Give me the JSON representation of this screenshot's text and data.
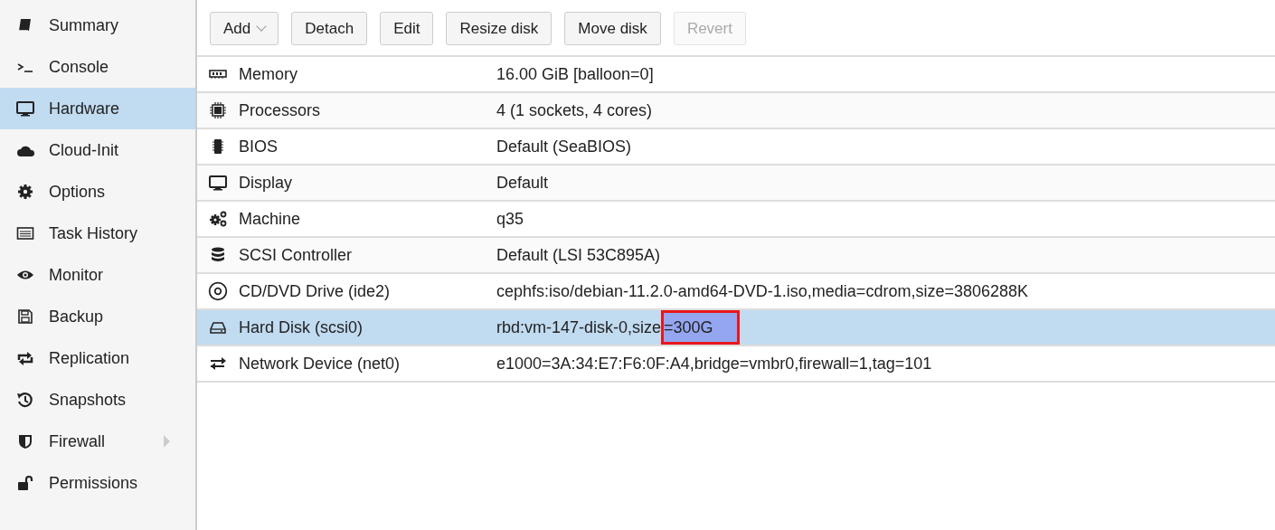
{
  "sidebar": {
    "items": [
      {
        "label": "Summary",
        "selected": false
      },
      {
        "label": "Console",
        "selected": false
      },
      {
        "label": "Hardware",
        "selected": true
      },
      {
        "label": "Cloud-Init",
        "selected": false
      },
      {
        "label": "Options",
        "selected": false
      },
      {
        "label": "Task History",
        "selected": false
      },
      {
        "label": "Monitor",
        "selected": false
      },
      {
        "label": "Backup",
        "selected": false
      },
      {
        "label": "Replication",
        "selected": false
      },
      {
        "label": "Snapshots",
        "selected": false
      },
      {
        "label": "Firewall",
        "selected": false,
        "expanded": false
      },
      {
        "label": "Permissions",
        "selected": false
      }
    ]
  },
  "toolbar": {
    "buttons": [
      {
        "label": "Add",
        "disabled": false,
        "menu": true
      },
      {
        "label": "Detach",
        "disabled": false
      },
      {
        "label": "Edit",
        "disabled": false
      },
      {
        "label": "Resize disk",
        "disabled": false
      },
      {
        "label": "Move disk",
        "disabled": false
      },
      {
        "label": "Revert",
        "disabled": true
      }
    ]
  },
  "table": {
    "rows": [
      {
        "name": "Memory",
        "value": "16.00 GiB [balloon=0]",
        "selected": false
      },
      {
        "name": "Processors",
        "value": "4 (1 sockets, 4 cores)",
        "selected": false
      },
      {
        "name": "BIOS",
        "value": "Default (SeaBIOS)",
        "selected": false
      },
      {
        "name": "Display",
        "value": "Default",
        "selected": false
      },
      {
        "name": "Machine",
        "value": "q35",
        "selected": false
      },
      {
        "name": "SCSI Controller",
        "value": "Default (LSI 53C895A)",
        "selected": false
      },
      {
        "name": "CD/DVD Drive (ide2)",
        "value": "cephfs:iso/debian-11.2.0-amd64-DVD-1.iso,media=cdrom,size=3806288K",
        "selected": false
      },
      {
        "name": "Hard Disk (scsi0)",
        "value": "rbd:vm-147-disk-0,size",
        "highlighted_value": "=300G",
        "selected": true
      },
      {
        "name": "Network Device (net0)",
        "value": "e1000=3A:34:E7:F6:0F:A4,bridge=vmbr0,firewall=1,tag=101",
        "selected": false
      }
    ]
  }
}
